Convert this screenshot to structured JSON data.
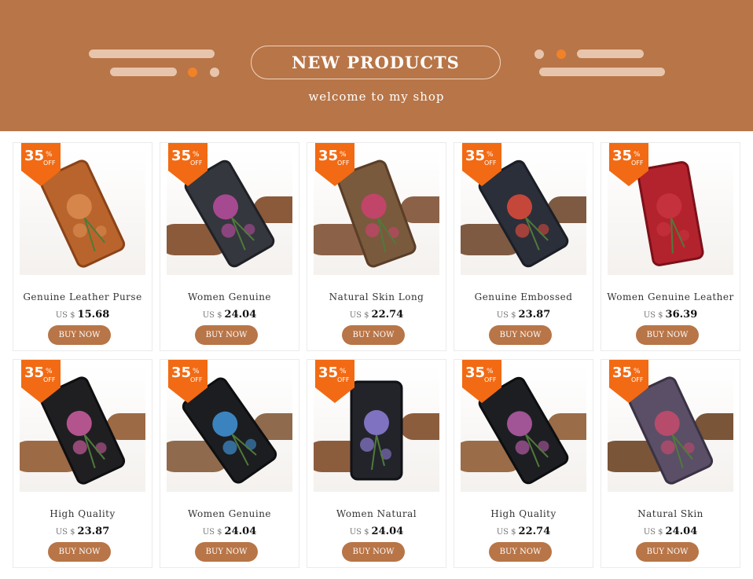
{
  "banner": {
    "title": "NEW PRODUCTS",
    "subtitle": "welcome to my shop"
  },
  "colors": {
    "banner": "#b87547",
    "accent": "#f0822a",
    "badge": "#f26a13",
    "button": "#b87547"
  },
  "products": [
    {
      "name": "Genuine Leather Purse",
      "currency": "US $",
      "price": "15.68",
      "discount": "35",
      "percent": "%",
      "off": "OFF",
      "button": "BUY NOW",
      "image": "orange-embossed-wallet"
    },
    {
      "name": "Women Genuine",
      "currency": "US $",
      "price": "24.04",
      "discount": "35",
      "percent": "%",
      "off": "OFF",
      "button": "BUY NOW",
      "image": "floral-painted-wallet"
    },
    {
      "name": "Natural Skin Long",
      "currency": "US $",
      "price": "22.74",
      "discount": "35",
      "percent": "%",
      "off": "OFF",
      "button": "BUY NOW",
      "image": "brown-flower-wallet"
    },
    {
      "name": "Genuine Embossed",
      "currency": "US $",
      "price": "23.87",
      "discount": "35",
      "percent": "%",
      "off": "OFF",
      "button": "BUY NOW",
      "image": "red-blue-flower-wallet"
    },
    {
      "name": "Women Genuine Leather",
      "currency": "US $",
      "price": "36.39",
      "discount": "35",
      "percent": "%",
      "off": "OFF",
      "button": "BUY NOW",
      "image": "red-rose-wallet"
    },
    {
      "name": "High Quality",
      "currency": "US $",
      "price": "23.87",
      "discount": "35",
      "percent": "%",
      "off": "OFF",
      "button": "BUY NOW",
      "image": "black-pink-rose-wallet"
    },
    {
      "name": "Women Genuine",
      "currency": "US $",
      "price": "24.04",
      "discount": "35",
      "percent": "%",
      "off": "OFF",
      "button": "BUY NOW",
      "image": "blue-flower-wallet"
    },
    {
      "name": "Women Natural",
      "currency": "US $",
      "price": "24.04",
      "discount": "35",
      "percent": "%",
      "off": "OFF",
      "button": "BUY NOW",
      "image": "rose-pattern-wallet"
    },
    {
      "name": "High Quality",
      "currency": "US $",
      "price": "22.74",
      "discount": "35",
      "percent": "%",
      "off": "OFF",
      "button": "BUY NOW",
      "image": "butterfly-wallet"
    },
    {
      "name": "Natural Skin",
      "currency": "US $",
      "price": "24.04",
      "discount": "35",
      "percent": "%",
      "off": "OFF",
      "button": "BUY NOW",
      "image": "bird-flower-wallet"
    }
  ]
}
